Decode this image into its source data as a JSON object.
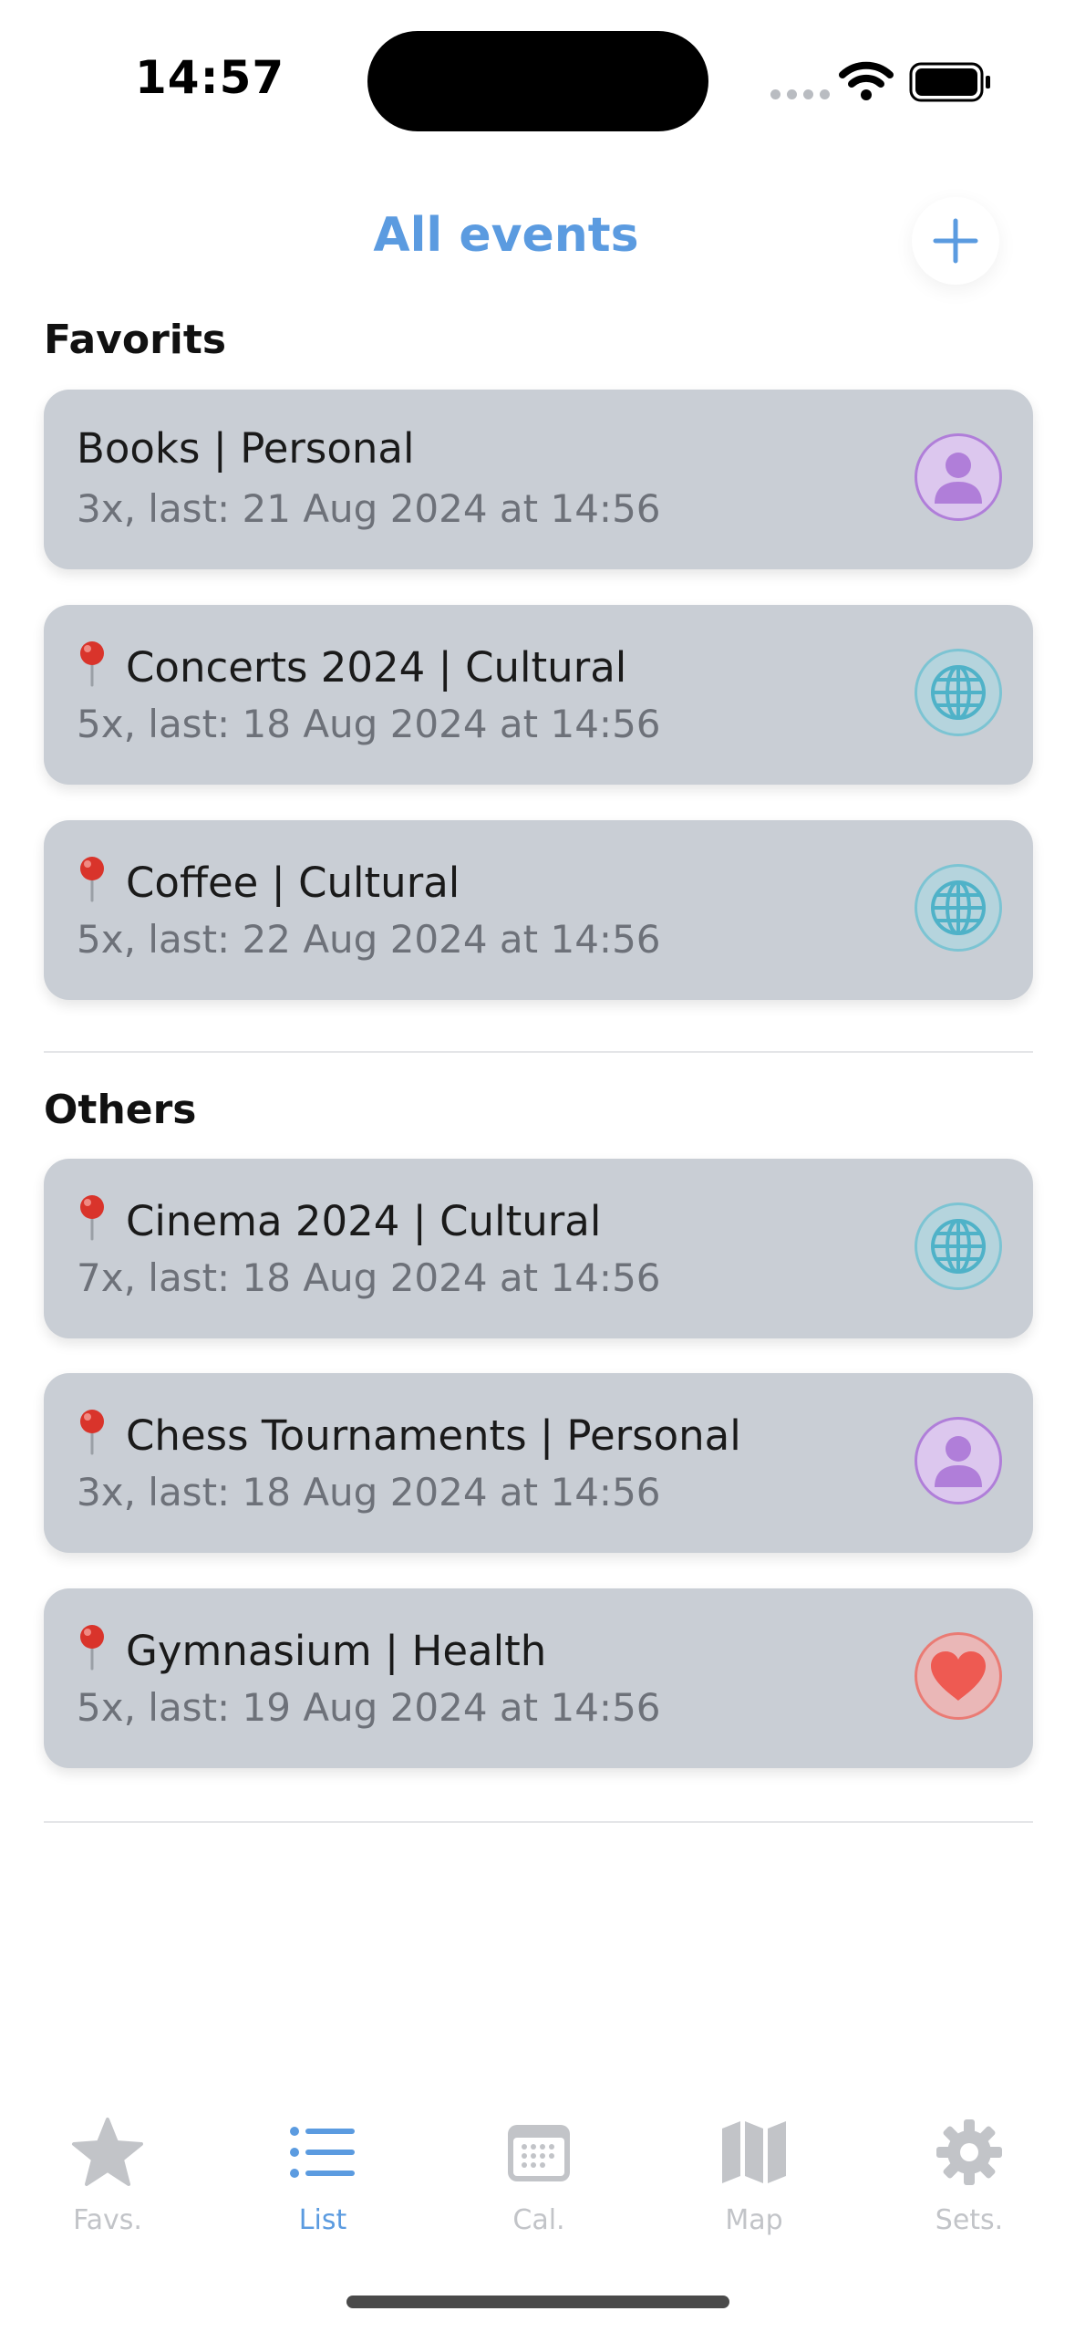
{
  "status_bar": {
    "time": "14:57"
  },
  "header": {
    "title": "All events",
    "add_icon": "plus-icon"
  },
  "sections": [
    {
      "title": "Favorits",
      "events": [
        {
          "title": "Books | Personal",
          "subtitle": "3x, last: 21 Aug 2024 at 14:56",
          "pin": false,
          "category": "personal",
          "icon": "person-icon"
        },
        {
          "title": "Concerts 2024 | Cultural",
          "subtitle": "5x, last: 18 Aug 2024 at 14:56",
          "pin": true,
          "category": "cultural",
          "icon": "globe-icon"
        },
        {
          "title": "Coffee | Cultural",
          "subtitle": "5x, last: 22 Aug 2024 at 14:56",
          "pin": true,
          "category": "cultural",
          "icon": "globe-icon"
        }
      ]
    },
    {
      "title": "Others",
      "events": [
        {
          "title": "Cinema 2024 | Cultural",
          "subtitle": "7x, last: 18 Aug 2024 at 14:56",
          "pin": true,
          "category": "cultural",
          "icon": "globe-icon"
        },
        {
          "title": "Chess Tournaments | Personal",
          "subtitle": "3x, last: 18 Aug 2024 at 14:56",
          "pin": true,
          "category": "personal",
          "icon": "person-icon"
        },
        {
          "title": "Gymnasium | Health",
          "subtitle": "5x, last: 19 Aug 2024 at 14:56",
          "pin": true,
          "category": "health",
          "icon": "heart-icon"
        }
      ]
    }
  ],
  "tab_bar": {
    "tabs": [
      {
        "label": "Favs.",
        "icon": "star-icon",
        "active": false
      },
      {
        "label": "List",
        "icon": "list-icon",
        "active": true
      },
      {
        "label": "Cal.",
        "icon": "calendar-icon",
        "active": false
      },
      {
        "label": "Map",
        "icon": "map-icon",
        "active": false
      },
      {
        "label": "Sets.",
        "icon": "gear-icon",
        "active": false
      }
    ]
  },
  "colors": {
    "accent": "#5b9be0",
    "card_background": "#c9ced5",
    "personal": "#b07ed9",
    "cultural": "#5ab8cc",
    "health": "#ee5a52",
    "tab_inactive": "#c2c4c8"
  }
}
